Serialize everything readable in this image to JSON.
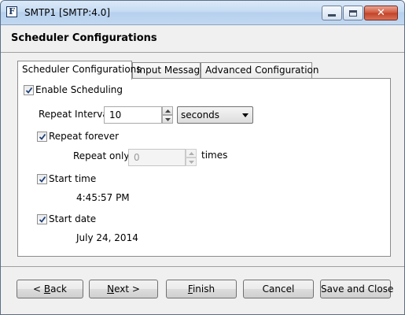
{
  "window": {
    "title": "SMTP1 [SMTP:4.0]",
    "app_icon_letter": "F"
  },
  "header": {
    "title": "Scheduler Configurations"
  },
  "tabs": [
    {
      "label": "Scheduler Configurations",
      "selected": true
    },
    {
      "label": "Input Message",
      "selected": false
    },
    {
      "label": "Advanced Configuration",
      "selected": false
    }
  ],
  "scheduler": {
    "enable_scheduling": {
      "label": "Enable Scheduling",
      "checked": true
    },
    "repeat_interval": {
      "label": "Repeat Interval:",
      "value": "10",
      "unit": "seconds"
    },
    "repeat_forever": {
      "label": "Repeat forever",
      "checked": true
    },
    "repeat_only": {
      "label": "Repeat only",
      "value": "0",
      "suffix": "times",
      "enabled": false
    },
    "start_time": {
      "label": "Start time",
      "checked": true,
      "value": "4:45:57 PM"
    },
    "start_date": {
      "label": "Start date",
      "checked": true,
      "value": "July 24, 2014"
    }
  },
  "buttons": {
    "back": {
      "prefix": "< ",
      "mnemonic": "B",
      "rest": "ack"
    },
    "next": {
      "mnemonic": "N",
      "rest": "ext >"
    },
    "finish": {
      "mnemonic": "F",
      "rest": "inish"
    },
    "cancel": {
      "label": "Cancel"
    },
    "save_and_close": {
      "label": "Save and Close"
    }
  },
  "colors": {
    "titlebar": "#c6dcf3",
    "close_button": "#c14227",
    "dialog_background": "#f0f0f0"
  }
}
